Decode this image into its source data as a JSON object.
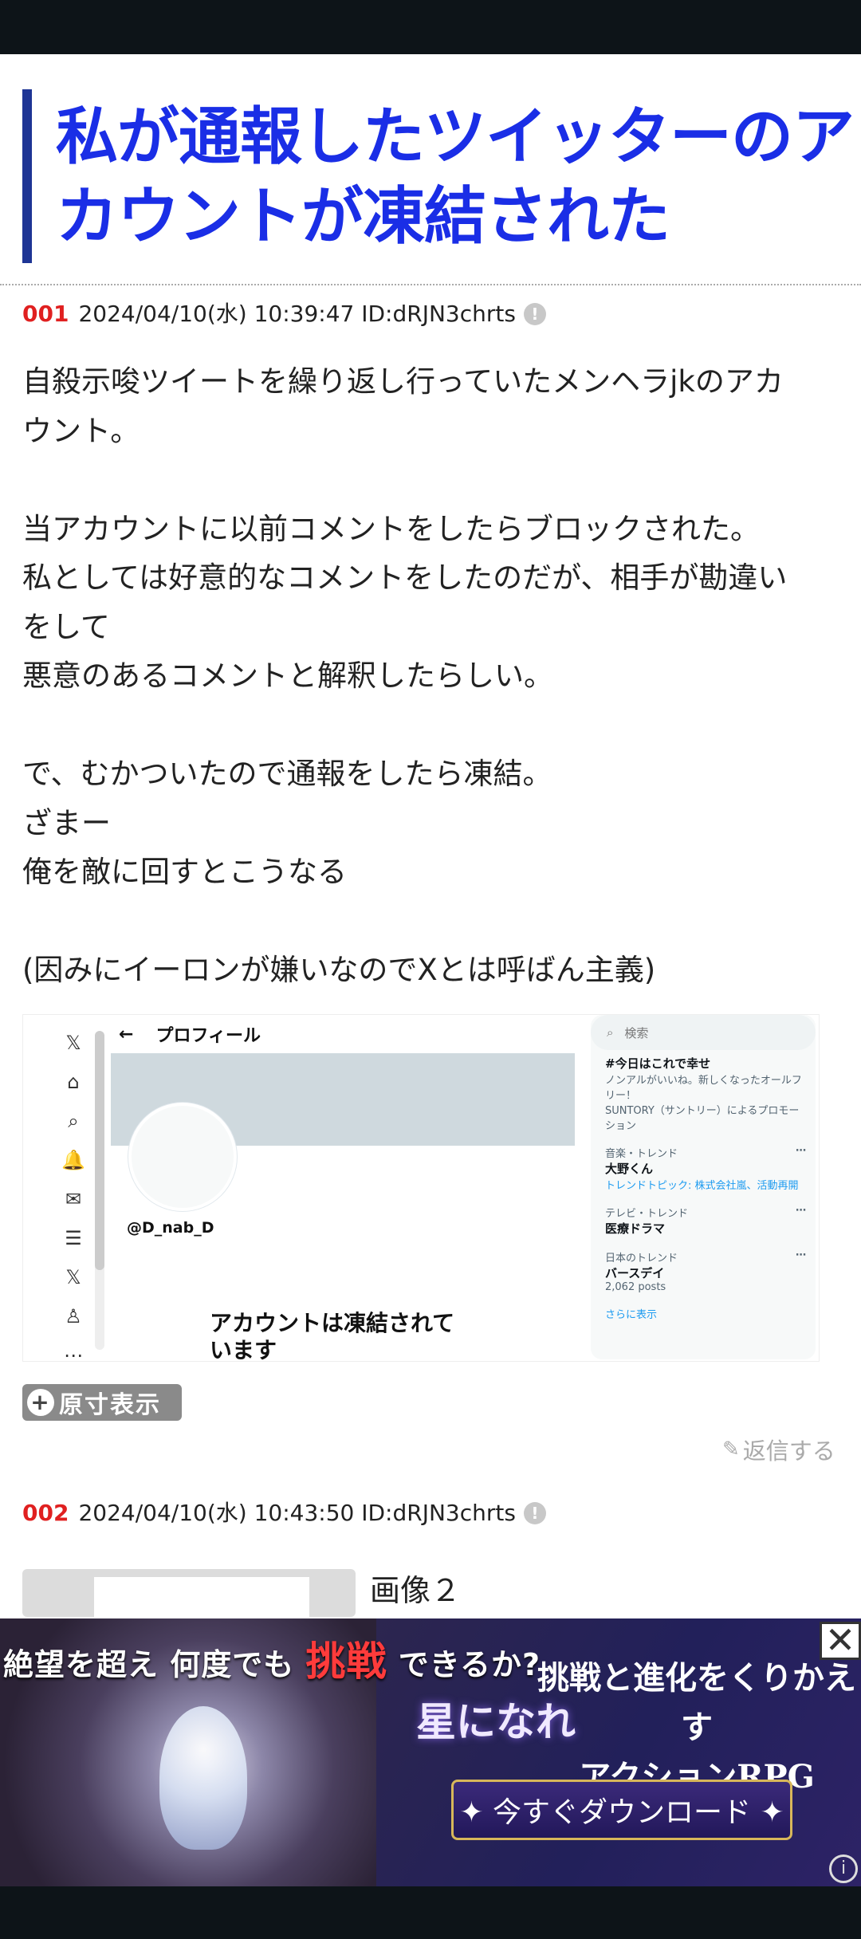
{
  "article": {
    "title": "私が通報したツイッターのア\nカウントが凍結された"
  },
  "posts": [
    {
      "number": "001",
      "meta": "2024/04/10(水) 10:39:47 ID:dRJN3chrts",
      "body": "自殺示唆ツイートを繰り返し行っていたメンヘラjkのアカ\nウント。\n\n当アカウントに以前コメントをしたらブロックされた。\n私としては好意的なコメントをしたのだが、相手が勘違い\nをして\n悪意のあるコメントと解釈したらしい。\n\nで、むかついたので通報をしたら凍結。\nざまー\n俺を敵に回すとこうなる\n\n(因みにイーロンが嫌いなのでXとは呼ばん主義)",
      "image": {
        "topbar_back": "←",
        "topbar_title": "プロフィール",
        "handle": "@D_nab_D",
        "frozen_message": "アカウントは凍結されて\nいます",
        "search_placeholder": "検索",
        "sidebar": [
          {
            "title": "#今日はこれで幸せ",
            "desc": "ノンアルがいいね。新しくなったオールフリー！",
            "sub": "SUNTORY（サントリー）によるプロモーション"
          },
          {
            "label": "音楽・トレンド",
            "title": "大野くん",
            "desc": "トレンドトピック: 株式会社嵐、活動再開"
          },
          {
            "label": "テレビ・トレンド",
            "title": "医療ドラマ"
          },
          {
            "label": "日本のトレンド",
            "title": "バースデイ",
            "desc": "2,062 posts"
          }
        ],
        "show_more": "さらに表示"
      },
      "zoom_label": "原寸表示",
      "reply_label": "返信する"
    },
    {
      "number": "002",
      "meta": "2024/04/10(水) 10:43:50 ID:dRJN3chrts",
      "image_caption": "画像２"
    }
  ],
  "ad": {
    "left_headline_1": "絶望を超え",
    "left_headline_2": "何度でも",
    "left_headline_emph": "挑戦",
    "left_headline_3": "できるか?",
    "logo": "星になれ",
    "right_headline": "挑戦と進化をくりかえす\nアクションRPG",
    "cta": "✦ 今すぐダウンロード ✦",
    "close": "✕",
    "info": "i"
  },
  "icons": {
    "x_logo": "𝕏",
    "home": "⌂",
    "search": "⌕",
    "bell": "🔔",
    "mail": "✉",
    "list": "☰",
    "person": "♙",
    "more": "⋯",
    "info": "!",
    "pencil": "✎",
    "magnifier": "+"
  }
}
